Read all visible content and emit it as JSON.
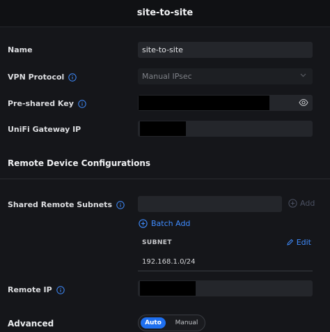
{
  "title": "site-to-site",
  "form": {
    "name": {
      "label": "Name",
      "value": "site-to-site"
    },
    "vpn_protocol": {
      "label": "VPN Protocol",
      "value": "Manual IPsec"
    },
    "pre_shared_key": {
      "label": "Pre-shared Key"
    },
    "gateway_ip": {
      "label": "UniFi Gateway IP"
    }
  },
  "remote": {
    "section_title": "Remote Device Configurations",
    "subnets": {
      "label": "Shared Remote Subnets",
      "add_label": "Add",
      "batch_add_label": "Batch Add"
    },
    "table": {
      "header": "SUBNET",
      "edit_label": "Edit",
      "rows": [
        "192.168.1.0/24"
      ]
    },
    "remote_ip": {
      "label": "Remote IP"
    }
  },
  "advanced": {
    "label": "Advanced",
    "options": [
      "Auto",
      "Manual"
    ],
    "selected": "Auto"
  },
  "icons": {
    "info": "info-icon",
    "dropdown": "chevron-down-icon",
    "visibility": "eye-icon",
    "add": "plus-circle-icon",
    "edit": "pencil-icon"
  },
  "colors": {
    "accent": "#1e6ff0",
    "link": "#3f8cff",
    "background": "#15161a",
    "field": "#24262b"
  }
}
